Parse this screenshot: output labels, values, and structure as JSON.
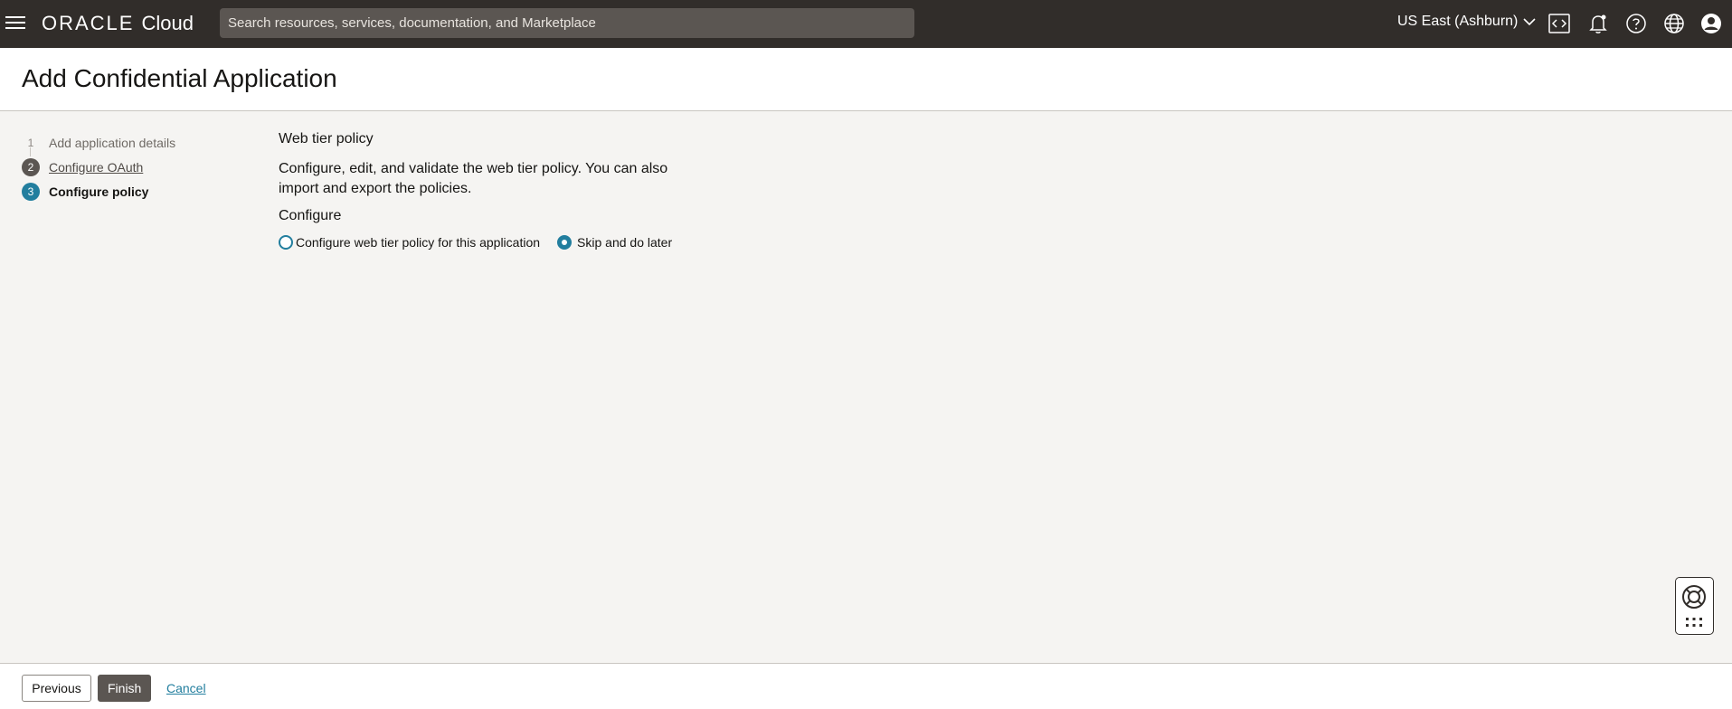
{
  "topbar": {
    "logo_oracle": "ORACLE",
    "logo_cloud": "Cloud",
    "search_placeholder": "Search resources, services, documentation, and Marketplace",
    "region": "US East (Ashburn)",
    "icons": [
      "menu-icon",
      "code-editor-icon",
      "notification-bell-icon",
      "help-icon",
      "language-globe-icon",
      "user-profile-icon"
    ]
  },
  "page": {
    "title": "Add Confidential Application"
  },
  "steps": [
    {
      "num": "1",
      "label": "Add application details",
      "state": "pending"
    },
    {
      "num": "2",
      "label": "Configure OAuth",
      "state": "completed"
    },
    {
      "num": "3",
      "label": "Configure policy",
      "state": "active"
    }
  ],
  "main": {
    "section_title": "Web tier policy",
    "description": "Configure, edit, and validate the web tier policy. You can also import and export the policies.",
    "configure_label": "Configure",
    "options": [
      {
        "label": "Configure web tier policy for this application",
        "selected": false
      },
      {
        "label": "Skip and do later",
        "selected": true
      }
    ]
  },
  "footer": {
    "previous_label": "Previous",
    "finish_label": "Finish",
    "cancel_label": "Cancel"
  },
  "colors": {
    "topbar_bg": "#312d2a",
    "accent": "#227e9e",
    "page_bg": "#f5f4f2",
    "search_bg": "#5b5652"
  }
}
